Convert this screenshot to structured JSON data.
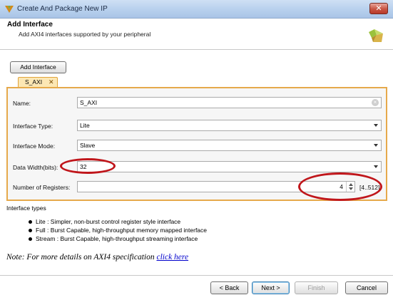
{
  "window": {
    "title": "Create And Package New IP",
    "close_glyph": "✕"
  },
  "header": {
    "title": "Add Interface",
    "subtitle": "Add AXI4 interfaces supported by your peripheral"
  },
  "toolbar": {
    "add_interface_label": "Add Interface"
  },
  "tab": {
    "label": "S_AXI",
    "close_glyph": "✕"
  },
  "form": {
    "name_label": "Name:",
    "name_value": "S_AXI",
    "name_clear_glyph": "×",
    "type_label": "Interface Type:",
    "type_value": "Lite",
    "mode_label": "Interface Mode:",
    "mode_value": "Slave",
    "width_label": "Data Width(bits):",
    "width_value": "32",
    "registers_label": "Number of Registers:",
    "registers_value": "4",
    "registers_range": "[4..512]"
  },
  "types": {
    "title": "Interface types",
    "items": [
      "Lite : Simpler, non-burst control register style interface",
      "Full : Burst Capable, high-throughput memory mapped interface",
      "Stream : Burst Capable, high-throughput streaming interface"
    ]
  },
  "note": {
    "text": "Note:  For more details on AXI4 specification ",
    "link": "click here"
  },
  "buttons": {
    "back": "< Back",
    "next": "Next >",
    "finish": "Finish",
    "cancel": "Cancel"
  },
  "colors": {
    "accent_orange": "#e6a94b",
    "annotation_red": "#c0161b",
    "tab_bg": "#fce7b4"
  }
}
